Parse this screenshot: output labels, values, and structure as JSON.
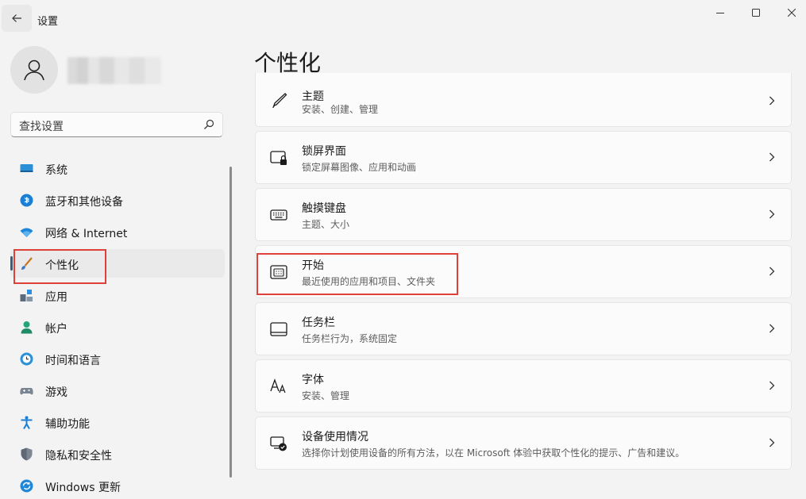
{
  "window": {
    "title": "设置"
  },
  "search": {
    "placeholder": "查找设置"
  },
  "sidebar": {
    "items": [
      {
        "label": "系统",
        "icon": "monitor-icon"
      },
      {
        "label": "蓝牙和其他设备",
        "icon": "bluetooth-icon"
      },
      {
        "label": "网络 & Internet",
        "icon": "wifi-icon"
      },
      {
        "label": "个性化",
        "icon": "brush-icon",
        "selected": true
      },
      {
        "label": "应用",
        "icon": "apps-icon"
      },
      {
        "label": "帐户",
        "icon": "account-icon"
      },
      {
        "label": "时间和语言",
        "icon": "time-language-icon"
      },
      {
        "label": "游戏",
        "icon": "gamepad-icon"
      },
      {
        "label": "辅助功能",
        "icon": "accessibility-icon"
      },
      {
        "label": "隐私和安全性",
        "icon": "shield-icon"
      },
      {
        "label": "Windows 更新",
        "icon": "update-icon"
      }
    ]
  },
  "main": {
    "title": "个性化",
    "cards": [
      {
        "title": "主题",
        "subtitle": "安装、创建、管理",
        "icon": "pen-icon"
      },
      {
        "title": "锁屏界面",
        "subtitle": "锁定屏幕图像、应用和动画",
        "icon": "lock-screen-icon"
      },
      {
        "title": "触摸键盘",
        "subtitle": "主题、大小",
        "icon": "keyboard-icon"
      },
      {
        "title": "开始",
        "subtitle": "最近使用的应用和项目、文件夹",
        "icon": "start-icon"
      },
      {
        "title": "任务栏",
        "subtitle": "任务栏行为，系统固定",
        "icon": "taskbar-icon"
      },
      {
        "title": "字体",
        "subtitle": "安装、管理",
        "icon": "font-icon"
      },
      {
        "title": "设备使用情况",
        "subtitle": "选择你计划使用设备的所有方法，以在 Microsoft 体验中获取个性化的提示、广告和建议。",
        "icon": "device-usage-icon"
      }
    ]
  },
  "colors": {
    "background": "#f3f3f3",
    "card": "#fbfbfb",
    "accent": "#3b5c7a",
    "highlight": "#e0403a"
  }
}
